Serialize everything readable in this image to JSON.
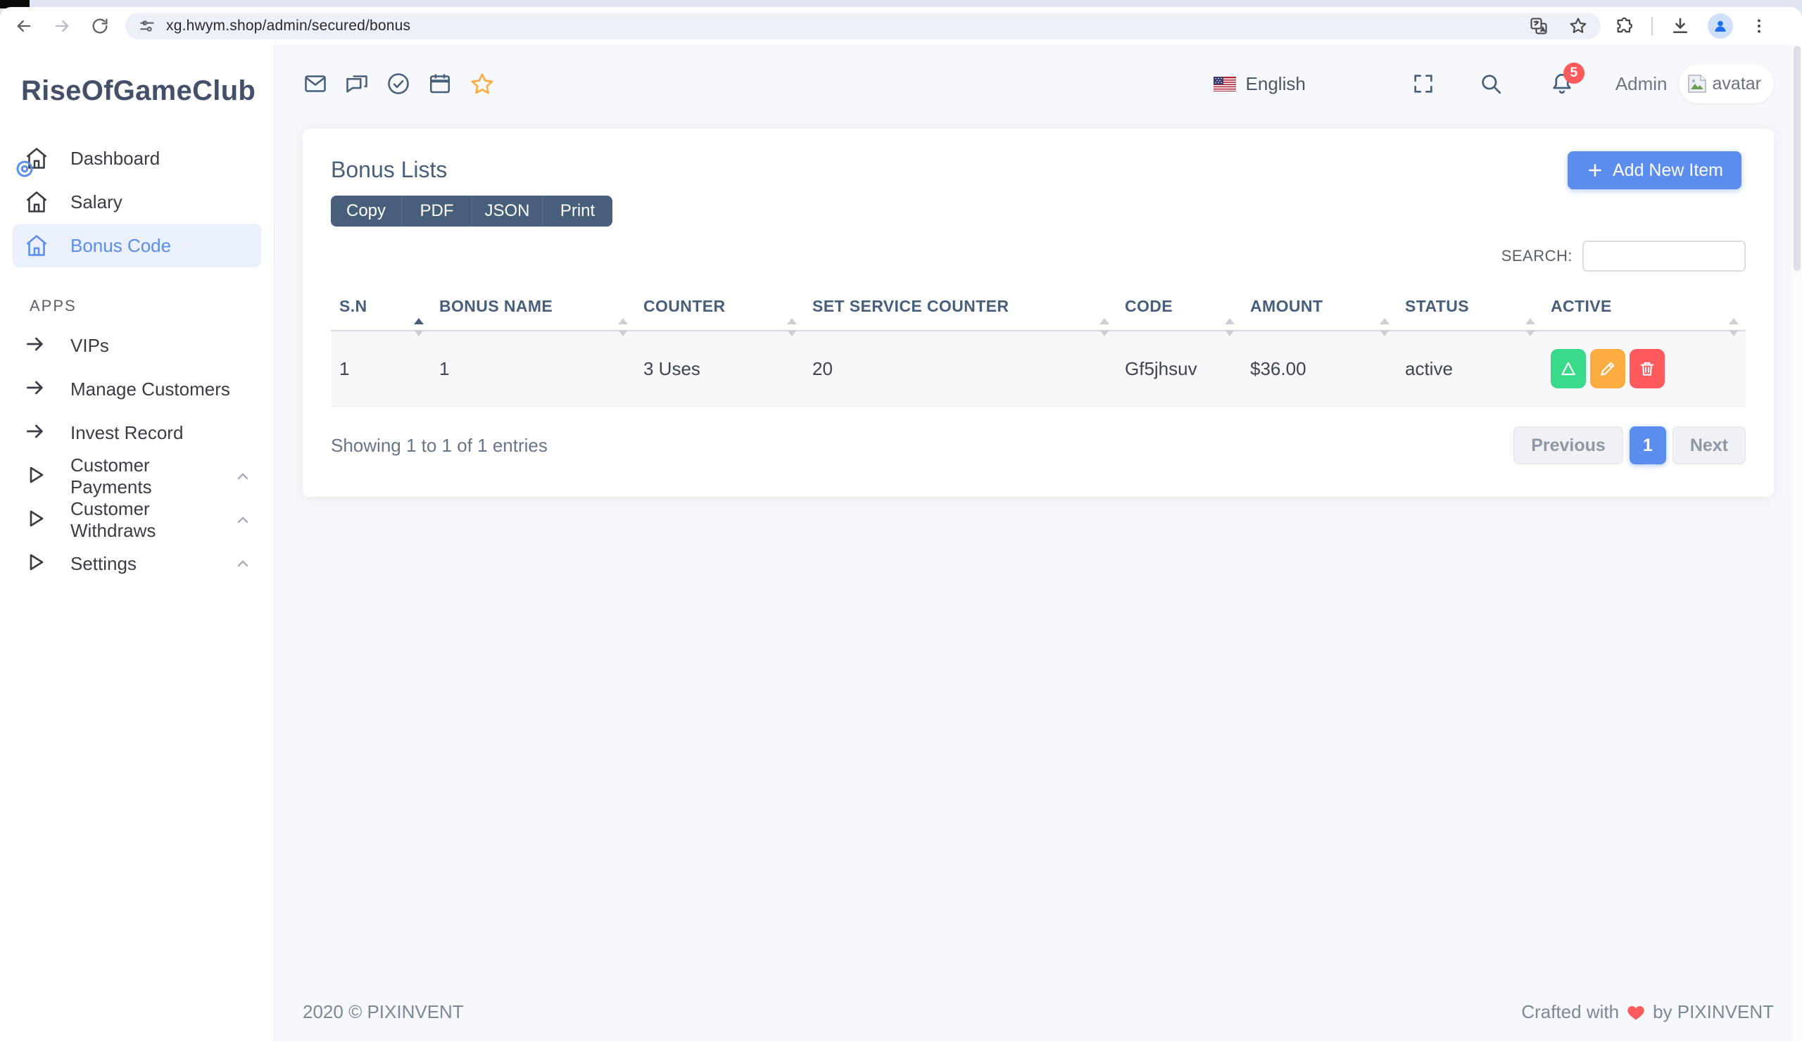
{
  "browser": {
    "url": "xg.hwym.shop/admin/secured/bonus"
  },
  "sidebar": {
    "brand": "RiseOfGameClub",
    "section": "APPS",
    "menu": [
      {
        "label": "Dashboard"
      },
      {
        "label": "Salary"
      },
      {
        "label": "Bonus Code"
      }
    ],
    "apps": [
      {
        "label": "VIPs"
      },
      {
        "label": "Manage Customers"
      },
      {
        "label": "Invest Record"
      },
      {
        "label": "Customer Payments"
      },
      {
        "label": "Customer Withdraws"
      },
      {
        "label": "Settings"
      }
    ]
  },
  "topbar": {
    "language": "English",
    "notifications": "5",
    "username": "Admin",
    "avatar_alt": "avatar"
  },
  "card": {
    "title": "Bonus Lists",
    "add_button": "Add New Item",
    "export_buttons": [
      "Copy",
      "PDF",
      "JSON",
      "Print"
    ],
    "search_label": "SEARCH:",
    "table": {
      "columns": [
        "S.N",
        "BONUS NAME",
        "COUNTER",
        "SET SERVICE COUNTER",
        "CODE",
        "AMOUNT",
        "STATUS",
        "ACTIVE"
      ],
      "rows": [
        {
          "sn": "1",
          "bonus_name": "1",
          "counter": "3 Uses",
          "set_service_counter": "20",
          "code": "Gf5jhsuv",
          "amount": "$36.00",
          "status": "active"
        }
      ]
    },
    "info": "Showing 1 to 1 of 1 entries",
    "pagination": {
      "previous": "Previous",
      "current": "1",
      "next": "Next"
    }
  },
  "footer": {
    "copyright": "2020 © PIXINVENT",
    "crafted_prefix": "Crafted with",
    "crafted_suffix": "by PIXINVENT"
  },
  "colors": {
    "accent": "#5a8dee",
    "dark": "#475f7b",
    "success": "#39da8a",
    "warning": "#fdac41",
    "danger": "#ff5b5c",
    "badge": "#ff5b5c"
  }
}
